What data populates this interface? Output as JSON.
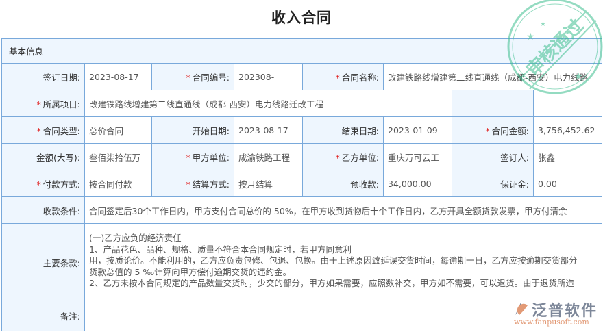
{
  "title": "收入合同",
  "section": "基本信息",
  "fields": {
    "sign_date": {
      "label": "签订日期:",
      "value": "2023-08-17"
    },
    "contract_no": {
      "label": "合同编号:",
      "value": "202308-"
    },
    "contract_name": {
      "label": "合同名称:",
      "value": "改建铁路线增建第二线直通线（成都-西安）电力线路"
    },
    "project": {
      "label": "所属项目:",
      "value": "改建铁路线增建第二线直通线（成都-西安）电力线路迁改工程"
    },
    "contract_type": {
      "label": "合同类型:",
      "value": "总价合同"
    },
    "start_date": {
      "label": "开始日期:",
      "value": "2023-08-17"
    },
    "end_date": {
      "label": "结束日期:",
      "value": "2023-01-09"
    },
    "amount": {
      "label": "合同金额:",
      "value": "3,756,452.62"
    },
    "amount_upper": {
      "label": "金额(大写):",
      "value": "叁佰柒拾伍万"
    },
    "party_a": {
      "label": "甲方单位:",
      "value": "成渝铁路工程"
    },
    "party_b": {
      "label": "乙方单位:",
      "value": "重庆万可云工"
    },
    "signer": {
      "label": "签订人:",
      "value": "张鑫"
    },
    "payment_method": {
      "label": "付款方式:",
      "value": "按合同付款"
    },
    "settlement": {
      "label": "结算方式:",
      "value": "按月结算"
    },
    "advance": {
      "label": "预收款:",
      "value": "34,000.00"
    },
    "deposit": {
      "label": "保证金:",
      "value": "0.00"
    },
    "terms": {
      "label": "收款条件:",
      "value": "合同签定后30个工作日内，甲方支付合同总价的 50%，在甲方收到货物后十个工作日内，乙方开具全额货款发票，甲方付清余"
    },
    "clauses": {
      "label": "主要条款:",
      "lines": [
        "(一)乙方应负的经济责任",
        "1、产品花色、品种、规格、质量不符合本合同规定时，若甲方同意利",
        "用，按质论价。不能利用的，乙方应负责包修、包退、包换。由于上述原因致延误交货时间，每逾期一日，乙方应按逾期交货部分",
        "货款总值的 5 ‰计算向甲方偿付逾期交货的违约金。",
        "2、乙方未按本合同规定的产品数量交货时，少交的部分，甲方如果需要，应照数补交，甲方如不需要，可以退货。由于退货所造"
      ]
    },
    "remark": {
      "label": "备注:",
      "value": ""
    }
  },
  "required_mark": "*",
  "stamp": {
    "text": "审核通过",
    "color": "#3dbf8f"
  },
  "logo": {
    "name": "泛普软件",
    "url": "www.fanpusoft.com"
  },
  "colors": {
    "border": "#79a9db",
    "label_bg": "#eef6fe",
    "required": "#e02020"
  }
}
